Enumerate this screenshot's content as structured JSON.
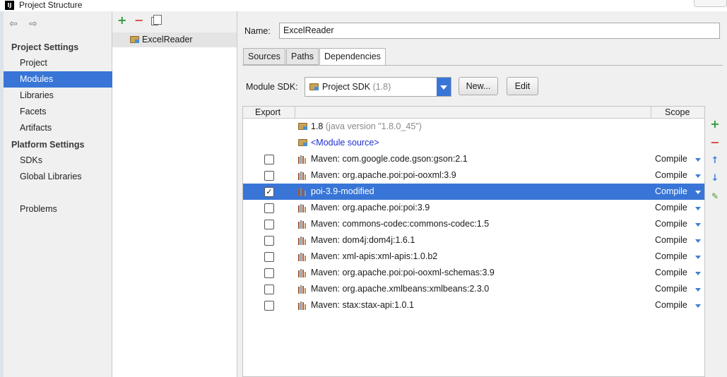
{
  "window": {
    "title": "Project Structure"
  },
  "sidebar": {
    "nav_arrows": "⇦ ⇨",
    "project_settings_header": "Project Settings",
    "project_items": [
      "Project",
      "Modules",
      "Libraries",
      "Facets",
      "Artifacts"
    ],
    "platform_settings_header": "Platform Settings",
    "platform_items": [
      "SDKs",
      "Global Libraries"
    ],
    "problems": "Problems",
    "selected": "Modules"
  },
  "modules": {
    "toolbar": {
      "add": "+",
      "remove": "−"
    },
    "items": [
      "ExcelReader"
    ]
  },
  "module": {
    "name_label": "Name:",
    "name_value": "ExcelReader",
    "tabs": [
      "Sources",
      "Paths",
      "Dependencies"
    ],
    "active_tab": "Dependencies",
    "sdk_label": "Module SDK:",
    "sdk_value": "Project SDK",
    "sdk_version": "(1.8)",
    "new_button": "New...",
    "edit_button": "Edit"
  },
  "dependencies": {
    "columns": {
      "export": "Export",
      "scope": "Scope"
    },
    "jdk_row": {
      "name": "1.8",
      "detail": "(java version \"1.8.0_45\")"
    },
    "module_source": "<Module source>",
    "rows": [
      {
        "name": "Maven: com.google.code.gson:gson:2.1",
        "scope": "Compile",
        "checked": false,
        "selected": false
      },
      {
        "name": "Maven: org.apache.poi:poi-ooxml:3.9",
        "scope": "Compile",
        "checked": false,
        "selected": false
      },
      {
        "name": "poi-3.9-modified",
        "scope": "Compile",
        "checked": true,
        "selected": true
      },
      {
        "name": "Maven: org.apache.poi:poi:3.9",
        "scope": "Compile",
        "checked": false,
        "selected": false
      },
      {
        "name": "Maven: commons-codec:commons-codec:1.5",
        "scope": "Compile",
        "checked": false,
        "selected": false
      },
      {
        "name": "Maven: dom4j:dom4j:1.6.1",
        "scope": "Compile",
        "checked": false,
        "selected": false
      },
      {
        "name": "Maven: xml-apis:xml-apis:1.0.b2",
        "scope": "Compile",
        "checked": false,
        "selected": false
      },
      {
        "name": "Maven: org.apache.poi:poi-ooxml-schemas:3.9",
        "scope": "Compile",
        "checked": false,
        "selected": false
      },
      {
        "name": "Maven: org.apache.xmlbeans:xmlbeans:2.3.0",
        "scope": "Compile",
        "checked": false,
        "selected": false
      },
      {
        "name": "Maven: stax:stax-api:1.0.1",
        "scope": "Compile",
        "checked": false,
        "selected": false
      }
    ],
    "side_toolbar": {
      "add": "+",
      "remove": "−",
      "up": "↑",
      "down": "↓",
      "edit": "✎"
    }
  },
  "colors": {
    "selection": "#3875d7",
    "add_green": "#2e9a3a",
    "remove_red": "#d8473a",
    "link_blue": "#1d2fd0"
  }
}
